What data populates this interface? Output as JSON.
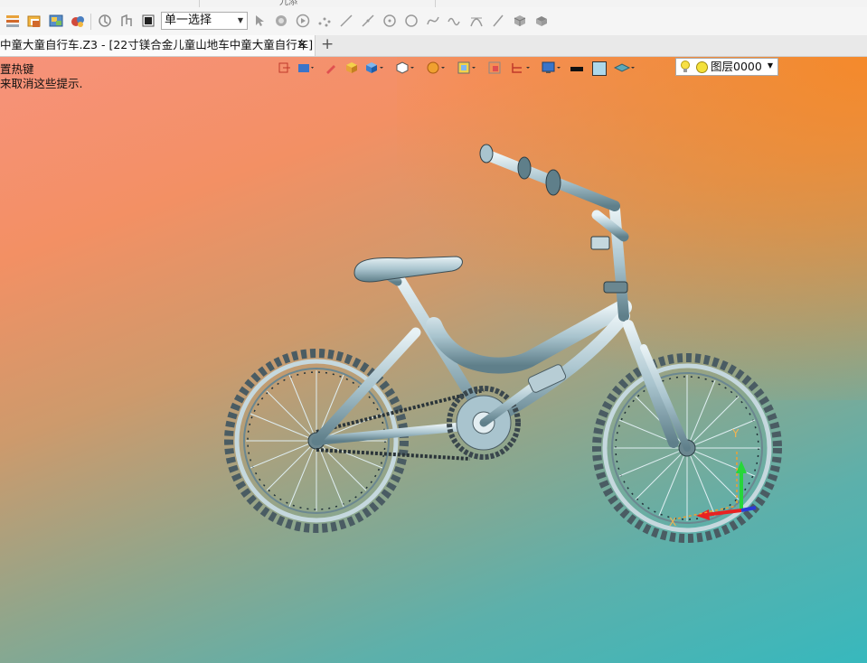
{
  "app": {
    "top_strip_right_fragment": "九添"
  },
  "toolbar": {
    "select_mode": "单一选择",
    "icons": [
      "layers-icon",
      "folder-icon",
      "image-icon",
      "visibility-icon",
      "rotate-icon",
      "filter-icon",
      "stop-icon",
      "pointer-icon",
      "object-icon",
      "play-icon",
      "points-icon",
      "line-icon",
      "line2-icon",
      "circle-point-icon",
      "circle-icon",
      "curve-icon",
      "wave-icon",
      "arc-icon",
      "slash-icon",
      "cube-icon",
      "solid-icon"
    ]
  },
  "tabs": [
    {
      "label": "中童大童自行车.Z3 - [22寸镁合金儿童山地车中童大童自行车]"
    }
  ],
  "hints": {
    "line1": "置热键",
    "line2": "来取消这些提示."
  },
  "view_toolbar": {
    "layer_label": "图层0000",
    "line_color": "#111111",
    "fill_color": "#add8ea"
  },
  "triad": {
    "x_label": "X",
    "y_label": "Y"
  },
  "colors": {
    "bg_top_left": "#f7927b",
    "bg_top_right": "#f68928",
    "bg_bottom_left": "#37b8bd",
    "bike": "#a9c4ce"
  }
}
